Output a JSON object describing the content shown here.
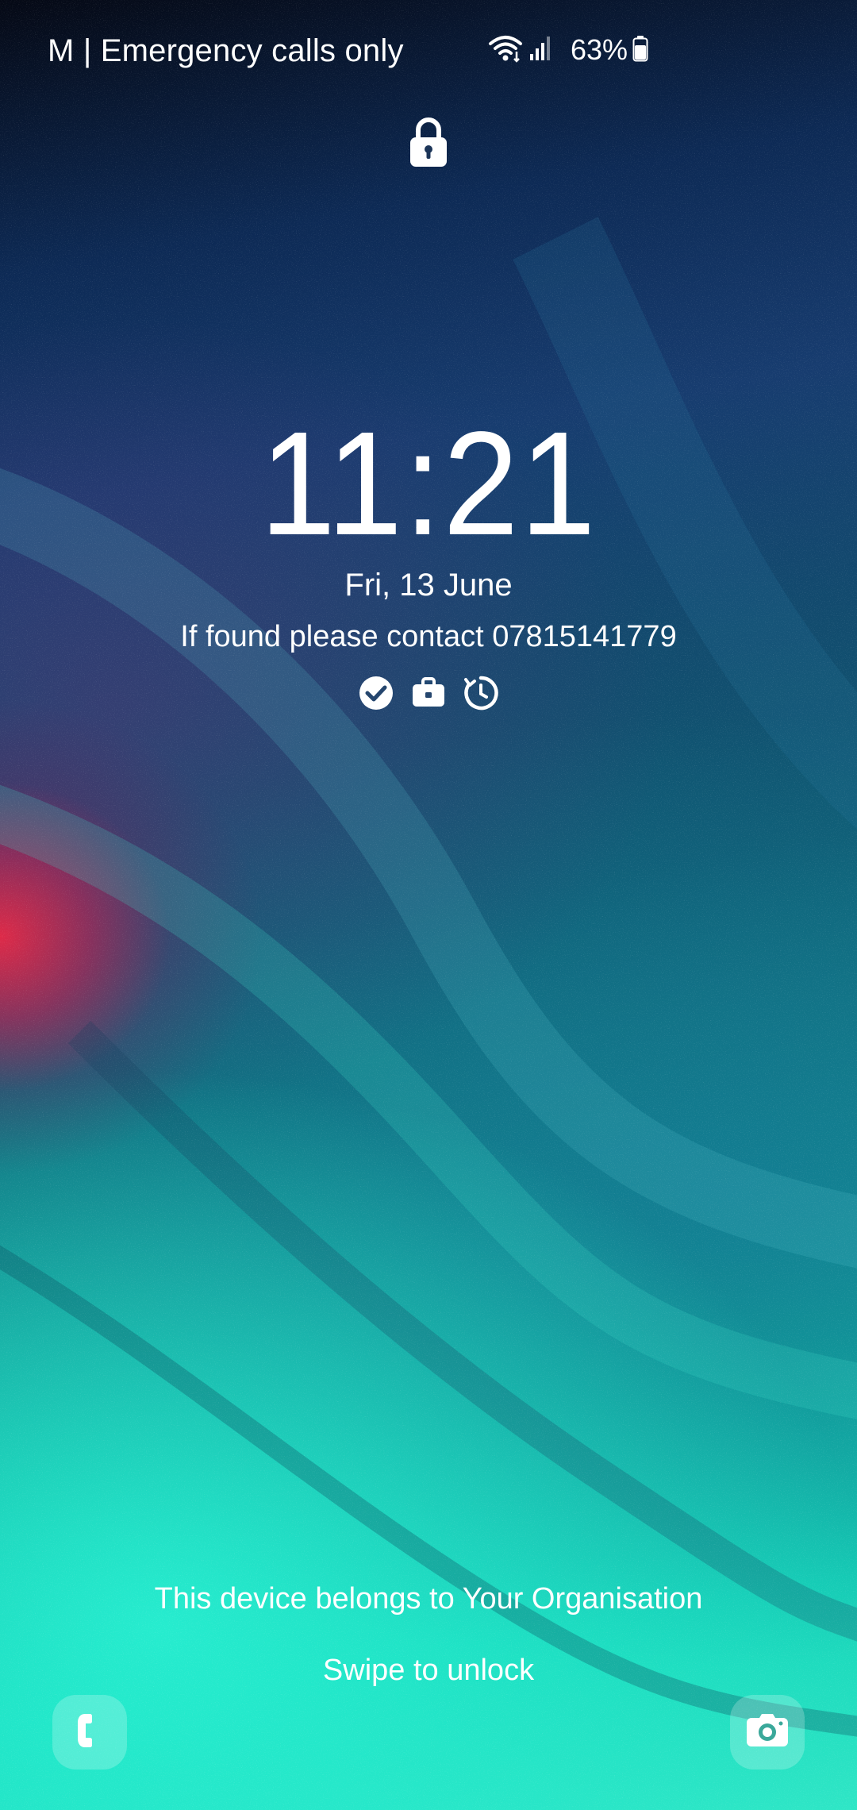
{
  "status_bar": {
    "carrier": "M | Emergency calls only",
    "battery": "63%",
    "icons": [
      "wifi-icon",
      "signal-icon",
      "battery-icon"
    ]
  },
  "lock": {
    "icon": "padlock-icon"
  },
  "clock": {
    "time": "11:21",
    "date": "Fri, 13 June"
  },
  "owner_info": "If found please contact 07815141779",
  "notification_icons": [
    "check-circle-icon",
    "briefcase-icon",
    "timer-icon"
  ],
  "footer": {
    "organisation_text": "This device belongs to Your Organisation",
    "unlock_hint": "Swipe to unlock"
  },
  "shortcuts": {
    "left": "phone-icon",
    "right": "camera-icon"
  },
  "colors": {
    "text": "#ffffff",
    "wallpaper_top": "#050915",
    "wallpaper_mid": "#0f5a72",
    "wallpaper_bottom": "#2fe6c6",
    "wallpaper_accent": "#e82846"
  }
}
